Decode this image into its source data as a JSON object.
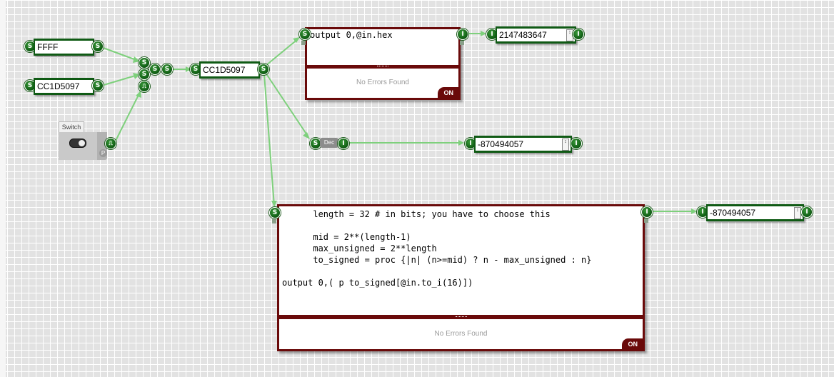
{
  "inputs": {
    "ffff": {
      "value": "FFFF",
      "port": "S"
    },
    "cc1d": {
      "value": "CC1D5097",
      "port": "S"
    }
  },
  "concat": {
    "in_a": "S",
    "in_b": "S",
    "in_pulse": "⎍",
    "out": "S",
    "mid": "S"
  },
  "switch": {
    "label": "Switch",
    "badge": "P",
    "out": "⎍"
  },
  "merged": {
    "value": "CC1D5097",
    "in": "S",
    "out": "S"
  },
  "editor_hex": {
    "in": "S",
    "out": "I",
    "code": "output 0,@in.hex",
    "status": "No Errors Found",
    "state": "ON"
  },
  "out_hex": {
    "value": "2147483647",
    "in": "I",
    "out": "I",
    "spin": "↕"
  },
  "dec_node": {
    "label": "Dec",
    "in": "S",
    "out": "I"
  },
  "out_dec": {
    "value": "-870494057",
    "in": "I",
    "out": "I",
    "spin": "↕"
  },
  "editor_signed": {
    "in": "S",
    "out": "I",
    "code": "      length = 32 # in bits; you have to choose this\n\n      mid = 2**(length-1)\n      max_unsigned = 2**length\n      to_signed = proc {|n| (n>=mid) ? n - max_unsigned : n}\n\noutput 0,( p to_signed[@in.to_i(16)])",
    "status": "No Errors Found",
    "state": "ON"
  },
  "out_signed": {
    "value": "-870494057",
    "in": "I",
    "out": "I",
    "spin": "↕"
  },
  "colors": {
    "port": "#0e5a12",
    "wire": "#7ed07c",
    "editor": "#6a0a0a"
  }
}
